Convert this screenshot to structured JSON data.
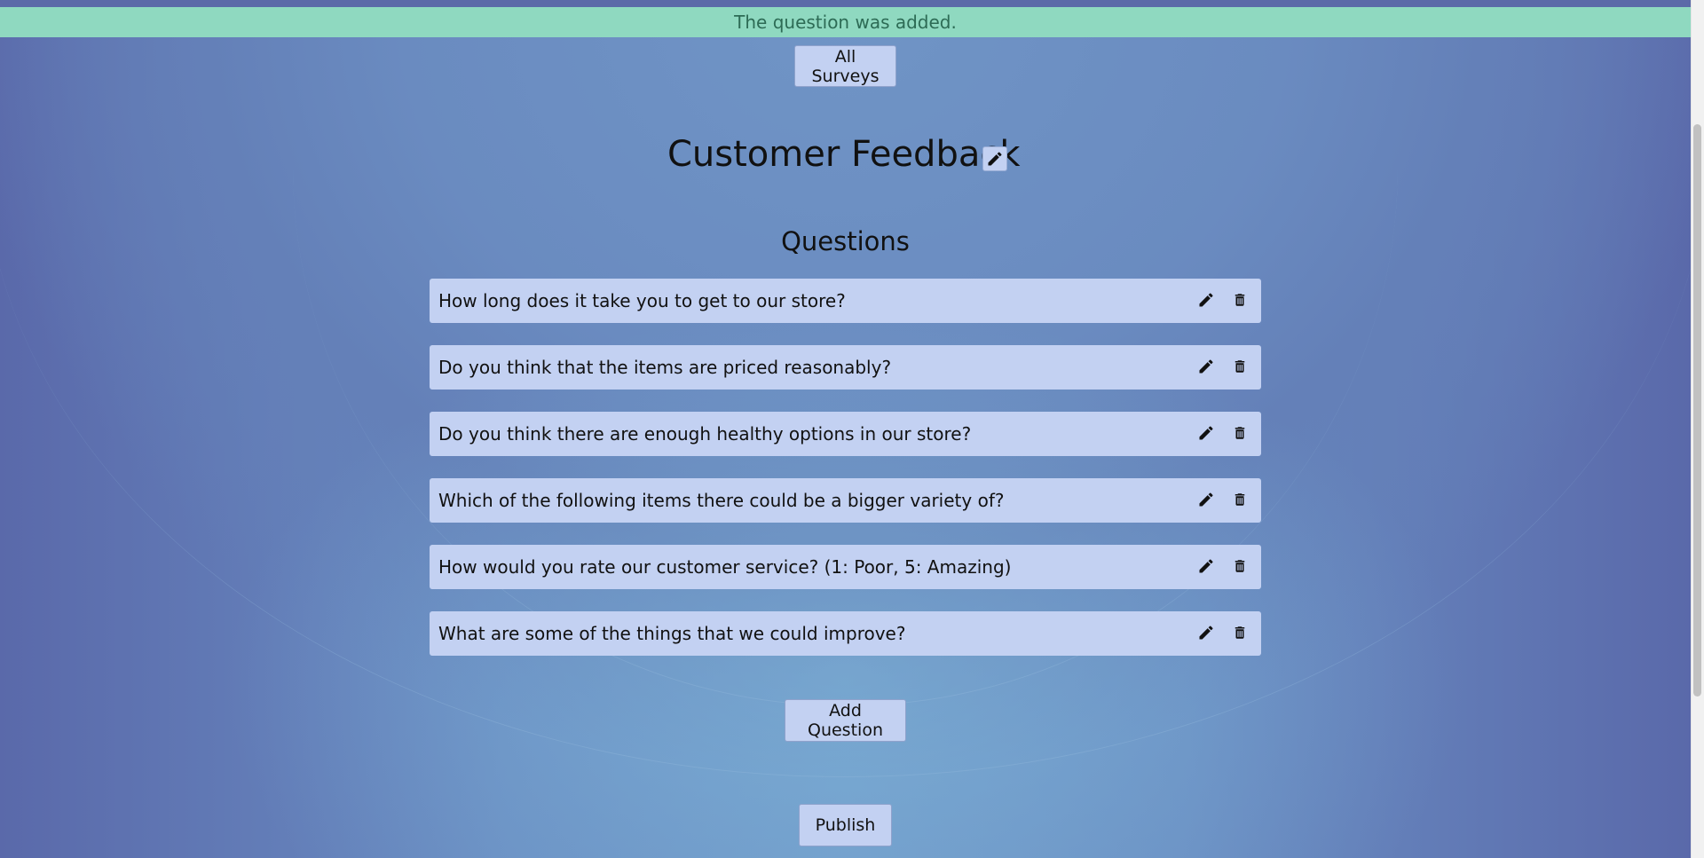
{
  "alert": {
    "message": "The question was added."
  },
  "nav": {
    "all_surveys_label": "All Surveys"
  },
  "survey": {
    "title": "Customer Feedback"
  },
  "questions_section": {
    "heading": "Questions",
    "items": [
      {
        "text": "How long does it take you to get to our store?"
      },
      {
        "text": "Do you think that the items are priced reasonably?"
      },
      {
        "text": "Do you think there are enough healthy options in our store?"
      },
      {
        "text": "Which of the following items there could be a bigger variety of?"
      },
      {
        "text": "How would you rate our customer service? (1: Poor, 5: Amazing)"
      },
      {
        "text": "What are some of the things that we could improve?"
      }
    ]
  },
  "actions": {
    "add_question_label": "Add Question",
    "publish_label": "Publish"
  },
  "icons": {
    "edit": "pencil-icon",
    "delete": "trash-icon"
  },
  "colors": {
    "alert_bg": "#8fd9c0",
    "alert_text": "#2d6b55",
    "row_bg": "#c3d1f2",
    "page_bg": "#6a8bc0"
  }
}
